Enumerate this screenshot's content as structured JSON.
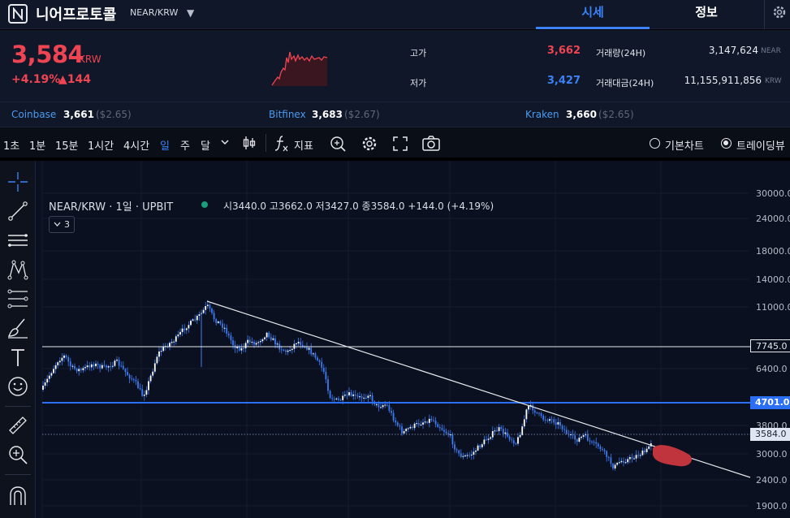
{
  "header": {
    "coin_name": "니어프로토콜",
    "pair": "NEAR/KRW",
    "tabs": [
      {
        "label": "시세",
        "active": true
      },
      {
        "label": "정보",
        "active": false
      }
    ]
  },
  "ticker": {
    "price": "3,584",
    "unit": "KRW",
    "change_pct": "+4.19%",
    "change_abs": "▲144",
    "high_label": "고가",
    "high": "3,662",
    "low_label": "저가",
    "low": "3,427",
    "volume_label": "거래량(24H)",
    "volume": "3,147,624",
    "volume_unit": "NEAR",
    "value_label": "거래대금(24H)",
    "value": "11,155,911,856",
    "value_unit": "KRW",
    "colors": {
      "up": "#ef4452",
      "down": "#3b82f6"
    }
  },
  "exchanges": [
    {
      "name": "Coinbase",
      "price": "3,661",
      "usd": "($2.65)"
    },
    {
      "name": "Bitfinex",
      "price": "3,683",
      "usd": "($2.67)"
    },
    {
      "name": "Kraken",
      "price": "3,660",
      "usd": "($2.65)"
    }
  ],
  "toolbar": {
    "timeframes": [
      "1초",
      "1분",
      "15분",
      "1시간",
      "4시간",
      "일",
      "주",
      "달"
    ],
    "active_timeframe": "일",
    "indicator_label": "지표",
    "chart_modes": [
      {
        "label": "기본차트",
        "selected": false
      },
      {
        "label": "트레이딩뷰",
        "selected": true
      }
    ],
    "icons": [
      "chevron-down-icon",
      "candlestick-icon",
      "function-icon",
      "compare-icon",
      "gear-icon",
      "fullscreen-icon",
      "camera-icon"
    ]
  },
  "left_tools": [
    "crosshair-icon",
    "trendline-icon",
    "parallel-lines-icon",
    "pattern-icon",
    "fib-icon",
    "brush-icon",
    "text-icon",
    "emoji-icon",
    "ruler-icon",
    "zoom-in-icon",
    "magnet-icon"
  ],
  "chart": {
    "title": "NEAR/KRW · 1일 · UPBIT",
    "ohlc": "시3440.0 고3662.0 저3427.0 종3584.0 +144.0 (+4.19%)",
    "collapsed_count": "3",
    "y_ticks": [
      "30000.0",
      "24000.0",
      "18000.0",
      "14000.0",
      "11000.0",
      "6400.0",
      "3800.0",
      "3000.0",
      "2400.0",
      "1900.0"
    ],
    "hline_upper": "7745.0",
    "hline_blue": "4701.0",
    "last_price": "3584.0",
    "candle_color": "#3d7bf0",
    "annotation_color": "#c0353d"
  }
}
